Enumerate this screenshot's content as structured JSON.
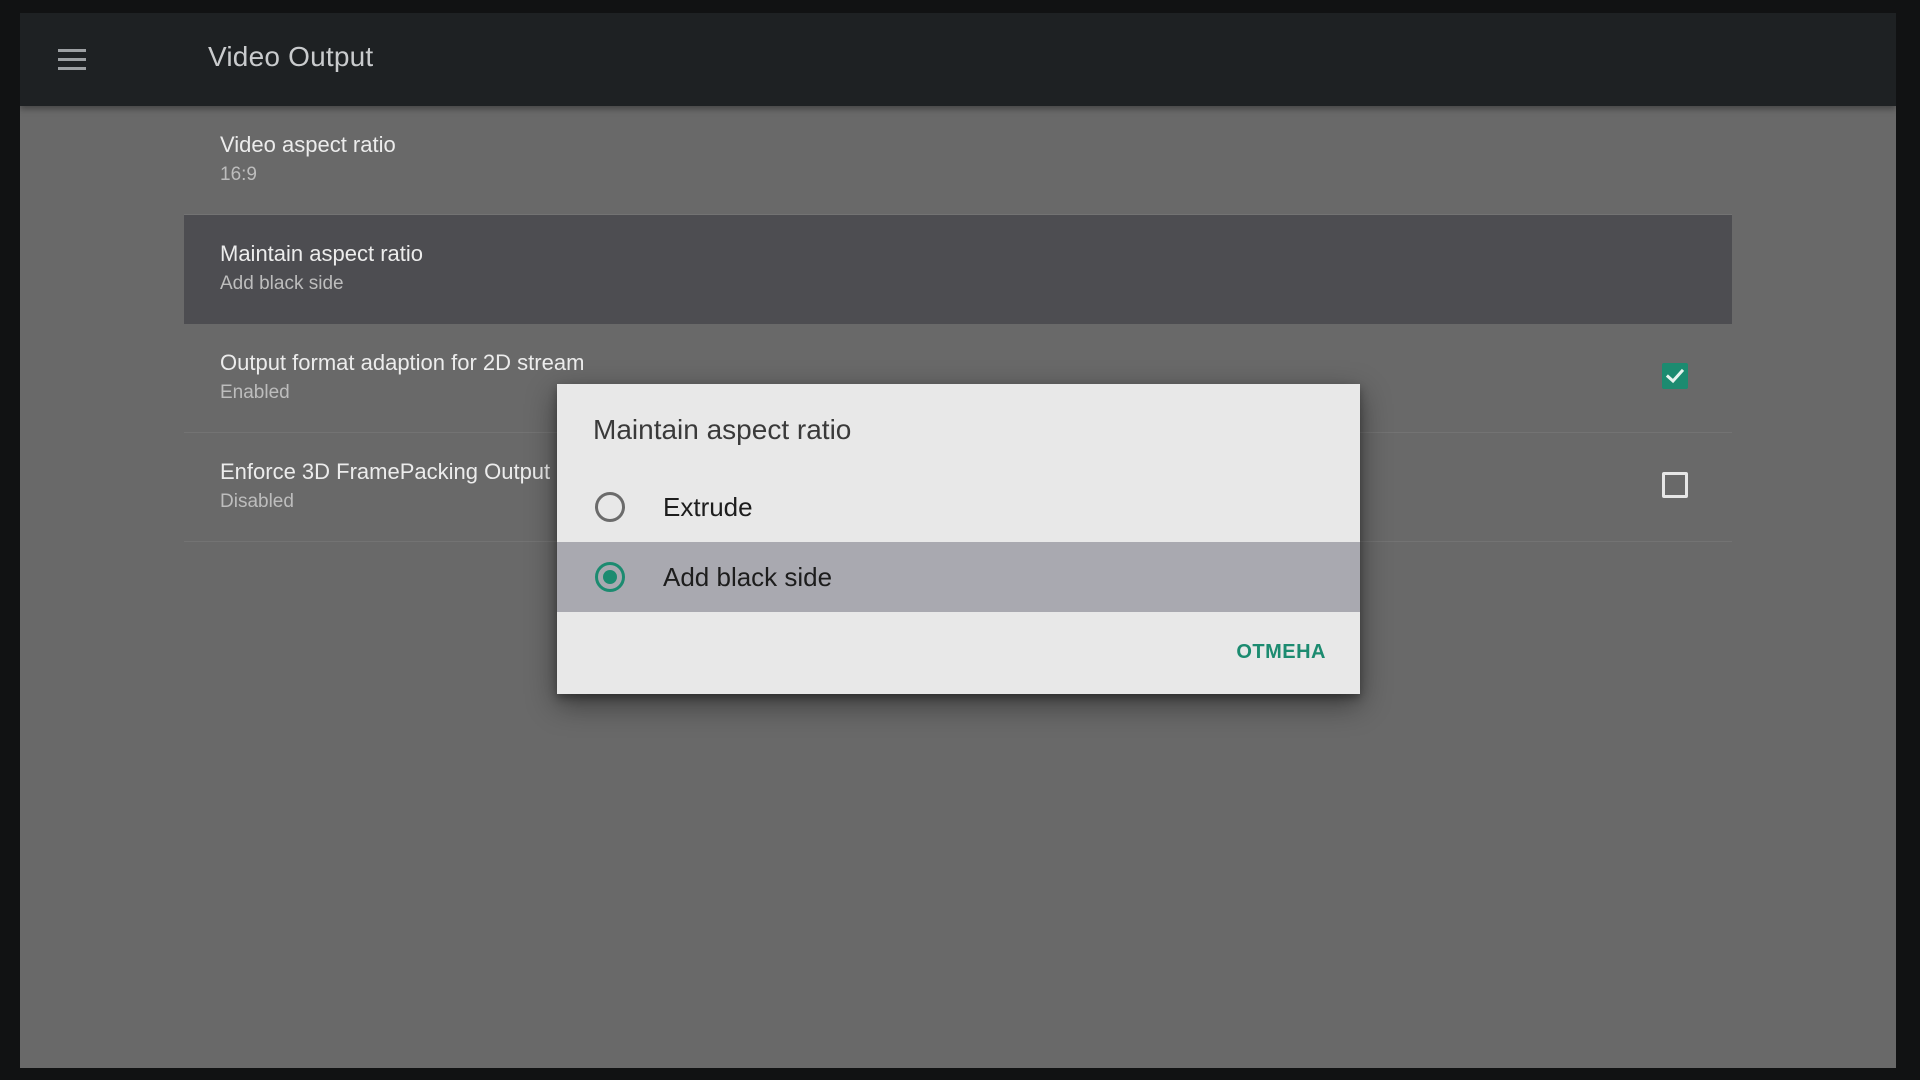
{
  "appbar": {
    "title": "Video Output",
    "menu_icon": "hamburger-menu-icon"
  },
  "settings": {
    "items": [
      {
        "title": "Video aspect ratio",
        "summary": "16:9"
      },
      {
        "title": "Maintain aspect ratio",
        "summary": "Add black side",
        "selected": true
      },
      {
        "title": "Output format adaption for 2D stream",
        "summary": "Enabled",
        "checkbox": true,
        "checked": true
      },
      {
        "title": "Enforce 3D FramePacking Output",
        "summary": "Disabled",
        "checkbox": true,
        "checked": false
      }
    ]
  },
  "dialog": {
    "title": "Maintain aspect ratio",
    "options": [
      {
        "label": "Extrude",
        "selected": false
      },
      {
        "label": "Add black side",
        "selected": true
      }
    ],
    "cancel_label": "ОТМЕНА"
  },
  "colors": {
    "accent": "#1c8b70",
    "appbar": "#1e2123",
    "background": "#696969",
    "dialog": "#e8e8e8",
    "selected_row": "#4d4d51",
    "selected_option": "#a9a9b0"
  }
}
